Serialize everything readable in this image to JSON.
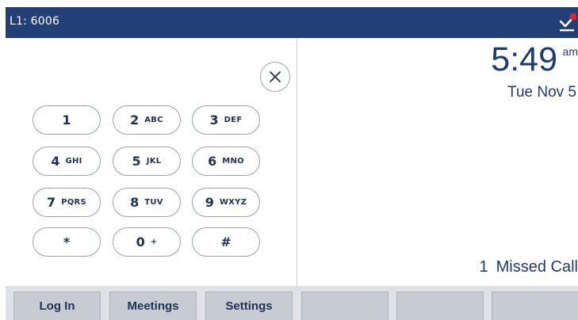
{
  "status_bar": {
    "line_label": "L1: 6006",
    "voicemail_icon": "voicemail-notification-icon",
    "background_color": "#233f78",
    "badge_color": "#e0242b"
  },
  "dialpad": {
    "clear_icon": "close-icon",
    "keys": [
      {
        "digit": "1",
        "letters": ""
      },
      {
        "digit": "2",
        "letters": "ABC"
      },
      {
        "digit": "3",
        "letters": "DEF"
      },
      {
        "digit": "4",
        "letters": "GHI"
      },
      {
        "digit": "5",
        "letters": "JKL"
      },
      {
        "digit": "6",
        "letters": "MNO"
      },
      {
        "digit": "7",
        "letters": "PQRS"
      },
      {
        "digit": "8",
        "letters": "TUV"
      },
      {
        "digit": "9",
        "letters": "WXYZ"
      },
      {
        "digit": "*",
        "letters": ""
      },
      {
        "digit": "0",
        "letters": "+"
      },
      {
        "digit": "#",
        "letters": ""
      }
    ]
  },
  "clock": {
    "time": "5:49",
    "ampm": "am",
    "date": "Tue Nov 5"
  },
  "missed_calls": {
    "count": "1",
    "label": "Missed Call"
  },
  "softkeys": [
    "Log In",
    "Meetings",
    "Settings",
    "",
    "",
    ""
  ]
}
